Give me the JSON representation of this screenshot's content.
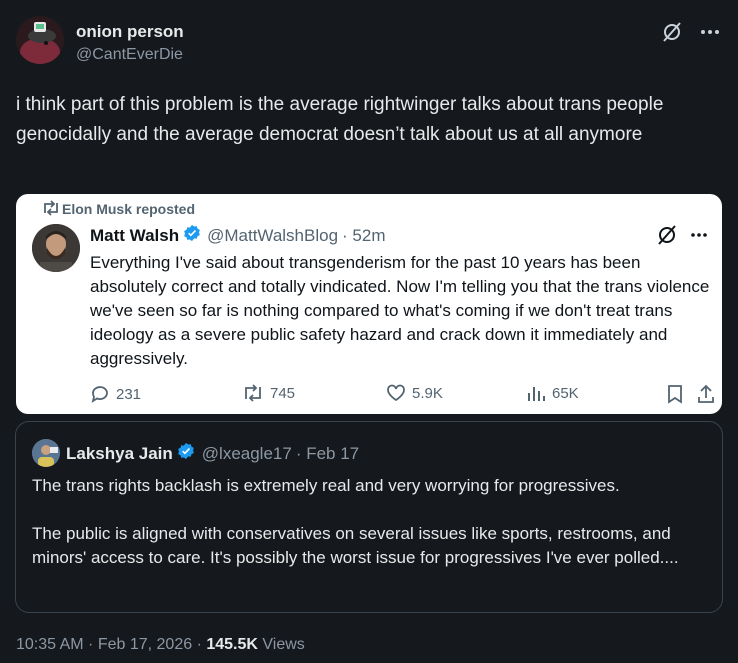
{
  "author": {
    "display_name": "onion person",
    "handle": "@CantEverDie"
  },
  "post": {
    "text": "i think part of this problem is the average rightwinger talks about trans people genocidally and the average democrat doesn’t talk about us at all anymore"
  },
  "embedded": {
    "repost_label": "Elon Musk reposted",
    "author_name": "Matt Walsh",
    "author_handle": "@MattWalshBlog",
    "time": "· 52m",
    "text": "Everything I've said about transgenderism for the past 10 years has been absolutely correct and totally vindicated. Now I'm telling you that the trans violence we've seen so far is nothing compared to what's coming if we don't treat trans ideology as a severe public safety hazard and crack down it immediately and aggressively.",
    "replies": "231",
    "reposts": "745",
    "likes": "5.9K",
    "views": "65K"
  },
  "quoted": {
    "author_name": "Lakshya Jain",
    "author_handle": "@lxeagle17",
    "time": "· Feb 17",
    "paragraph1": "The trans rights backlash is extremely real and very worrying for progressives.",
    "paragraph2": "The public is aligned with conservatives on several issues like sports, restrooms, and minors' access to care. It's possibly the worst issue for progressives I've ever polled...."
  },
  "footer": {
    "timestamp": "10:35 AM · Feb 17, 2026 · ",
    "views_count": "145.5K",
    "views_label": " Views"
  },
  "colors": {
    "background": "#15181c",
    "verified": "#1d9bf0"
  }
}
